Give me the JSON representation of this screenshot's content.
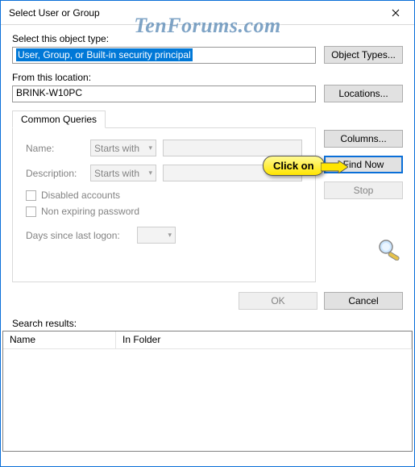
{
  "window": {
    "title": "Select User or Group"
  },
  "watermark": "TenForums.com",
  "labels": {
    "object_type": "Select this object type:",
    "from_location": "From this location:",
    "search_results": "Search results:"
  },
  "inputs": {
    "object_type_value": "User, Group, or Built-in security principal",
    "from_location_value": "BRINK-W10PC"
  },
  "buttons": {
    "object_types": "Object Types...",
    "locations": "Locations...",
    "columns": "Columns...",
    "find_now": "Find Now",
    "stop": "Stop",
    "ok": "OK",
    "cancel": "Cancel"
  },
  "tabs": {
    "common_queries": "Common Queries"
  },
  "queries": {
    "name_label": "Name:",
    "desc_label": "Description:",
    "starts_with": "Starts with",
    "disabled_accounts": "Disabled accounts",
    "non_expiring": "Non expiring password",
    "days_since": "Days since last logon:"
  },
  "columns": {
    "name": "Name",
    "in_folder": "In Folder"
  },
  "callout": {
    "text": "Click on"
  }
}
